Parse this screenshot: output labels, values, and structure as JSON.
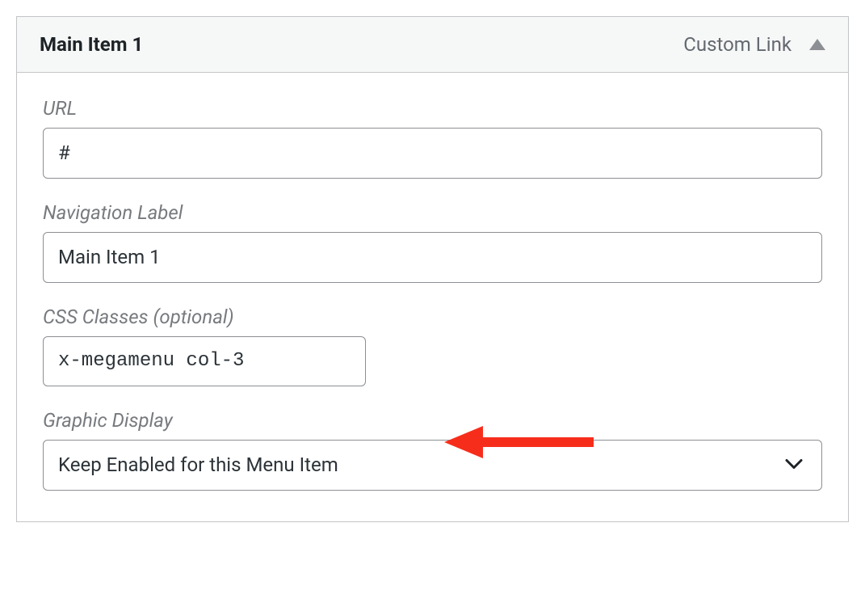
{
  "header": {
    "title": "Main Item 1",
    "type_label": "Custom Link"
  },
  "fields": {
    "url": {
      "label": "URL",
      "value": "#"
    },
    "nav_label": {
      "label": "Navigation Label",
      "value": "Main Item 1"
    },
    "css_classes": {
      "label": "CSS Classes (optional)",
      "value": "x-megamenu col-3"
    },
    "graphic_display": {
      "label": "Graphic Display",
      "value": "Keep Enabled for this Menu Item"
    }
  },
  "annotation": {
    "color": "#f72d1c"
  }
}
